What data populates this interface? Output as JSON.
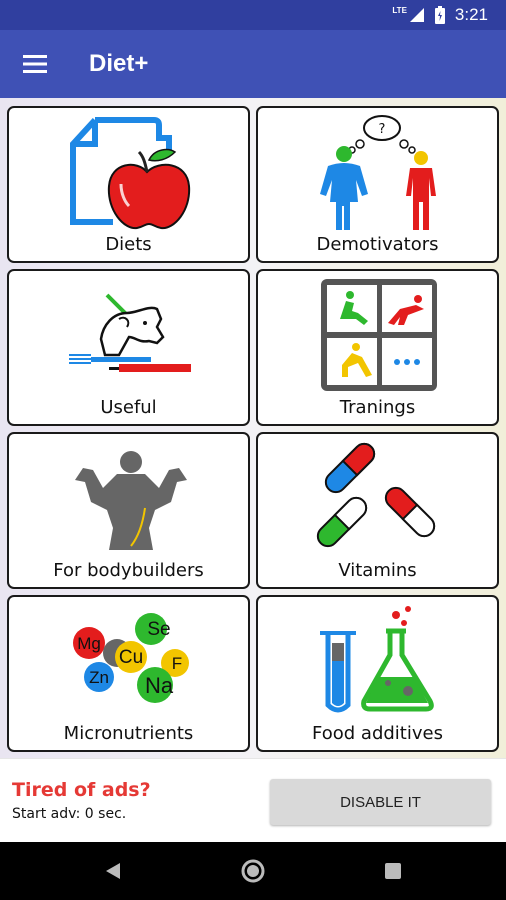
{
  "status_bar": {
    "network": "LTE",
    "time": "3:21"
  },
  "app_bar": {
    "title": "Diet+"
  },
  "tiles": [
    {
      "label": "Diets",
      "icon": "diet-plan-apple-icon"
    },
    {
      "label": "Demotivators",
      "icon": "thinking-people-icon"
    },
    {
      "label": "Useful",
      "icon": "unicorn-cutlery-icon"
    },
    {
      "label": "Tranings",
      "icon": "exercise-grid-icon"
    },
    {
      "label": "For bodybuilders",
      "icon": "bodybuilder-icon"
    },
    {
      "label": "Vitamins",
      "icon": "capsules-icon"
    },
    {
      "label": "Micronutrients",
      "icon": "element-circles-icon"
    },
    {
      "label": "Food additives",
      "icon": "lab-flask-icon"
    }
  ],
  "micronutrient_symbols": [
    "Mg",
    "Se",
    "Cu",
    "F",
    "Zn",
    "Na"
  ],
  "ad_bar": {
    "title": "Tired of ads?",
    "subtitle": "Start adv: 0 sec.",
    "button_label": "DISABLE IT"
  },
  "colors": {
    "status_bar": "#303f9f",
    "app_bar": "#3f51b5",
    "ad_title": "#e53935",
    "button": "#d9d9d9"
  }
}
